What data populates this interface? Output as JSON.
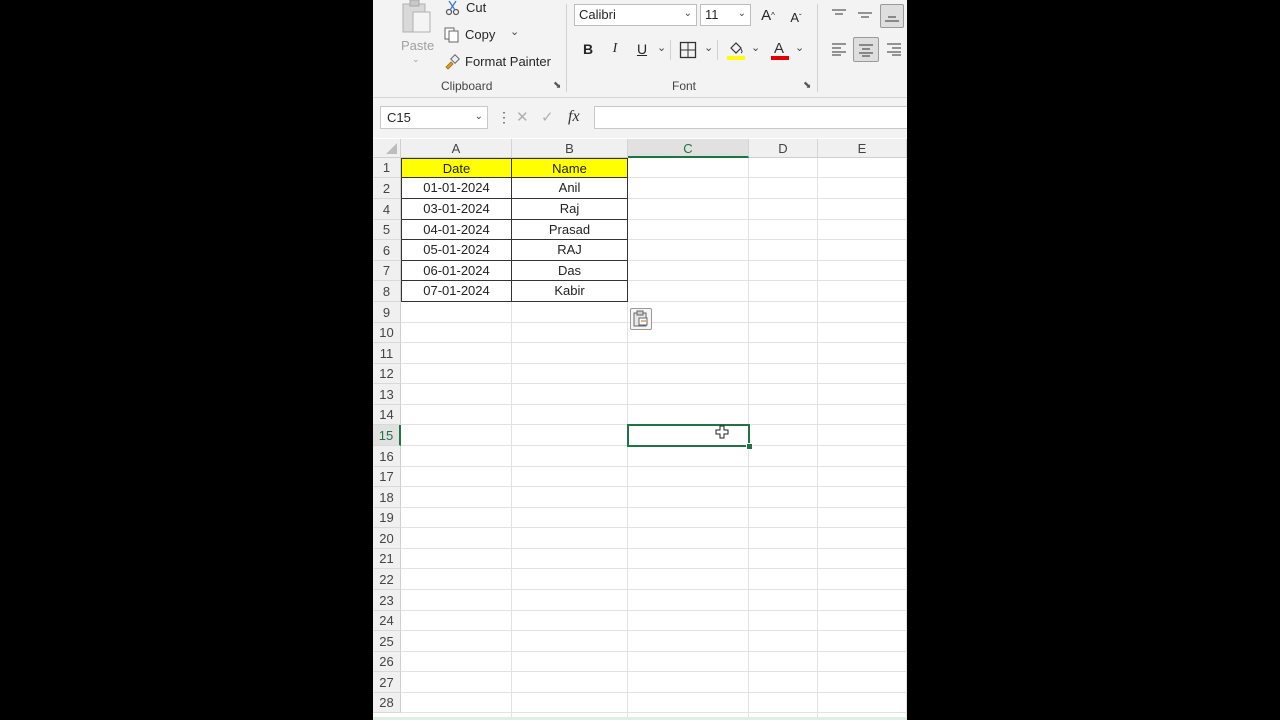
{
  "ribbon": {
    "clipboard": {
      "paste_label": "Paste",
      "cut_label": "Cut",
      "copy_label": "Copy",
      "format_painter_label": "Format Painter",
      "group_label": "Clipboard"
    },
    "font": {
      "font_name": "Calibri",
      "font_size": "11",
      "bold": "B",
      "italic": "I",
      "underline": "U",
      "group_label": "Font",
      "highlight_color": "#ffff00",
      "font_color": "#e00000"
    }
  },
  "formula_bar": {
    "name_box": "C15",
    "fx_label": "fx",
    "formula": ""
  },
  "sheet": {
    "columns": [
      "A",
      "B",
      "C",
      "D",
      "E"
    ],
    "selected_column": "C",
    "rows": [
      "1",
      "2",
      "4",
      "5",
      "6",
      "7",
      "8",
      "9",
      "10",
      "11",
      "12",
      "13",
      "14",
      "15",
      "16",
      "17",
      "18",
      "19",
      "20",
      "21",
      "22",
      "23",
      "24",
      "25",
      "26",
      "27",
      "28"
    ],
    "selected_row": "15",
    "table": {
      "headers": [
        "Date",
        "Name"
      ],
      "rows": [
        [
          "01-01-2024",
          "Anil"
        ],
        [
          "03-01-2024",
          "Raj"
        ],
        [
          "04-01-2024",
          "Prasad"
        ],
        [
          "05-01-2024",
          "RAJ"
        ],
        [
          "06-01-2024",
          "Das"
        ],
        [
          "07-01-2024",
          "Kabir"
        ]
      ]
    },
    "header_fill_color": "#ffff00",
    "selection_color": "#217346"
  }
}
